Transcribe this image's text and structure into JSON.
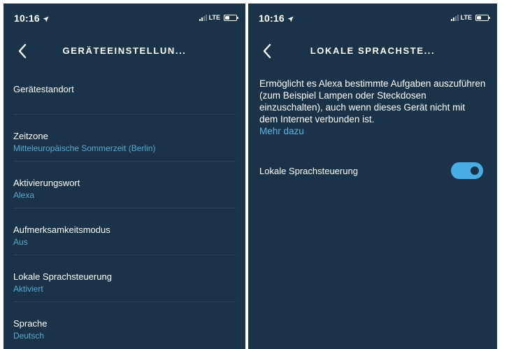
{
  "colors": {
    "background": "#1b3348",
    "accent": "#5aa8d2",
    "toggle_on": "#48aee4",
    "divider": "#2c4358"
  },
  "left_screen": {
    "status": {
      "time": "10:16",
      "network": "LTE"
    },
    "nav": {
      "title": "GERÄTEEINSTELLUN..."
    },
    "items": [
      {
        "label": "Gerätestandort",
        "value": ""
      },
      {
        "label": "Zeitzone",
        "value": "Mitteleuropäische Sommerzeit (Berlin)"
      },
      {
        "label": "Aktivierungswort",
        "value": "Alexa"
      },
      {
        "label": "Aufmerksamkeitsmodus",
        "value": "Aus"
      },
      {
        "label": "Lokale Sprachsteuerung",
        "value": "Aktiviert"
      },
      {
        "label": "Sprache",
        "value": "Deutsch"
      }
    ]
  },
  "right_screen": {
    "status": {
      "time": "10:16",
      "network": "LTE"
    },
    "nav": {
      "title": "LOKALE SPRACHSTE..."
    },
    "description": "Ermöglicht es Alexa bestimmte Aufgaben auszuführen (zum Beispiel Lampen oder Steckdosen einzuschalten), auch wenn dieses Gerät nicht mit dem Internet verbunden ist.",
    "more_link": "Mehr dazu",
    "toggle": {
      "label": "Lokale Sprachsteuerung",
      "enabled": true
    }
  }
}
